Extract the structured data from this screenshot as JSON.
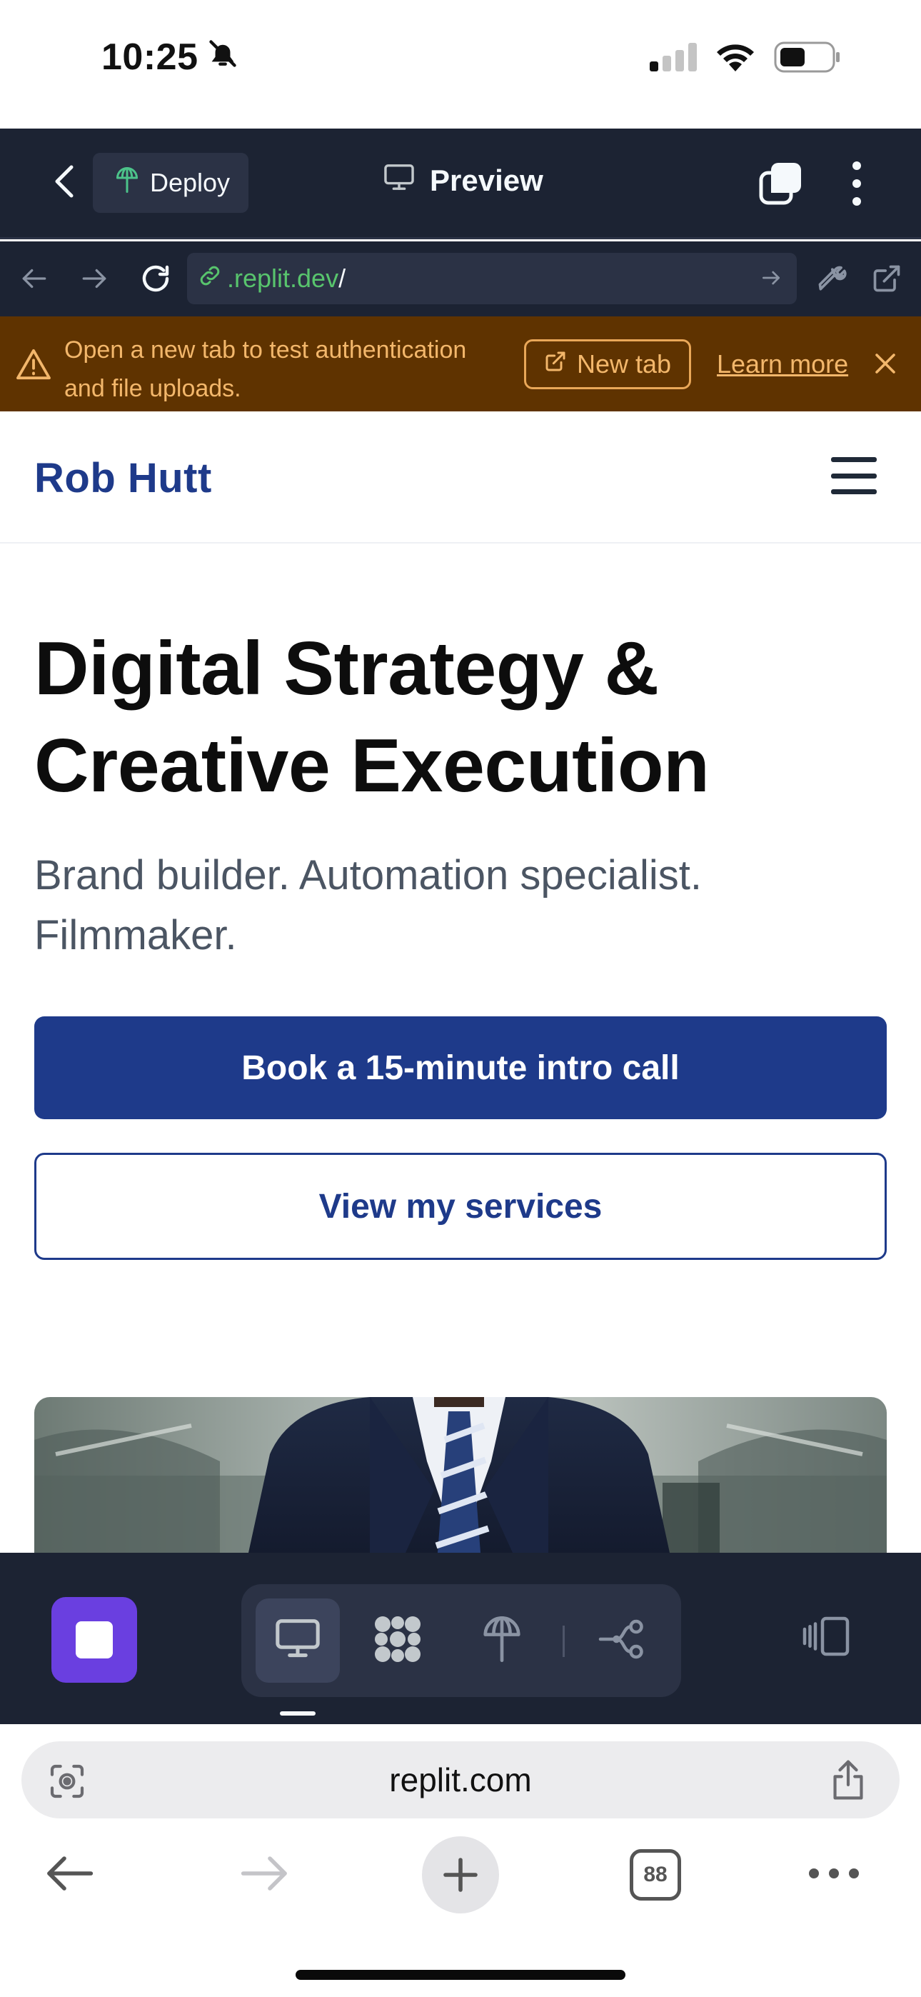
{
  "status_bar": {
    "time": "10:25"
  },
  "replit_header": {
    "deploy_label": "Deploy",
    "preview_label": "Preview"
  },
  "replit_url": {
    "host": ".replit.dev",
    "path": "/"
  },
  "banner": {
    "text": "Open a new tab to test authentication and file uploads.",
    "new_tab_label": "New tab",
    "learn_more_label": "Learn more"
  },
  "site": {
    "logo": "Rob Hutt",
    "hero_title": "Digital Strategy & Creative Execution",
    "hero_subtitle": "Brand builder. Automation specialist. Filmmaker.",
    "primary_cta": "Book a 15-minute intro call",
    "secondary_cta": "View my services"
  },
  "safari": {
    "url": "replit.com",
    "tab_count": "88"
  },
  "colors": {
    "replit_bg": "#1c2333",
    "replit_panel": "#2b3245",
    "banner_bg": "#5f3300",
    "banner_text": "#f3b76b",
    "brand_blue": "#1e3a8a",
    "stop_purple": "#6a3fe0",
    "url_green": "#58c46d"
  },
  "icons": {
    "status": [
      "bell-slash-icon",
      "signal-icon",
      "wifi-icon",
      "battery-icon"
    ],
    "replit_header": [
      "chevron-left-icon",
      "deploy-icon",
      "monitor-icon",
      "tabs-icon",
      "more-vertical-icon"
    ],
    "replit_url": [
      "arrow-left-icon",
      "arrow-right-icon",
      "reload-icon",
      "link-icon",
      "arrow-go-icon",
      "wrench-icon",
      "external-link-icon"
    ],
    "banner": [
      "warning-icon",
      "external-link-icon",
      "close-icon"
    ],
    "replit_bottom": [
      "stop-icon",
      "monitor-icon",
      "apps-icon",
      "deploy-icon",
      "branch-icon",
      "layout-icon"
    ],
    "safari": [
      "page-menu-icon",
      "share-icon",
      "back-icon",
      "forward-icon",
      "plus-icon",
      "tabs-icon",
      "more-horizontal-icon"
    ]
  }
}
